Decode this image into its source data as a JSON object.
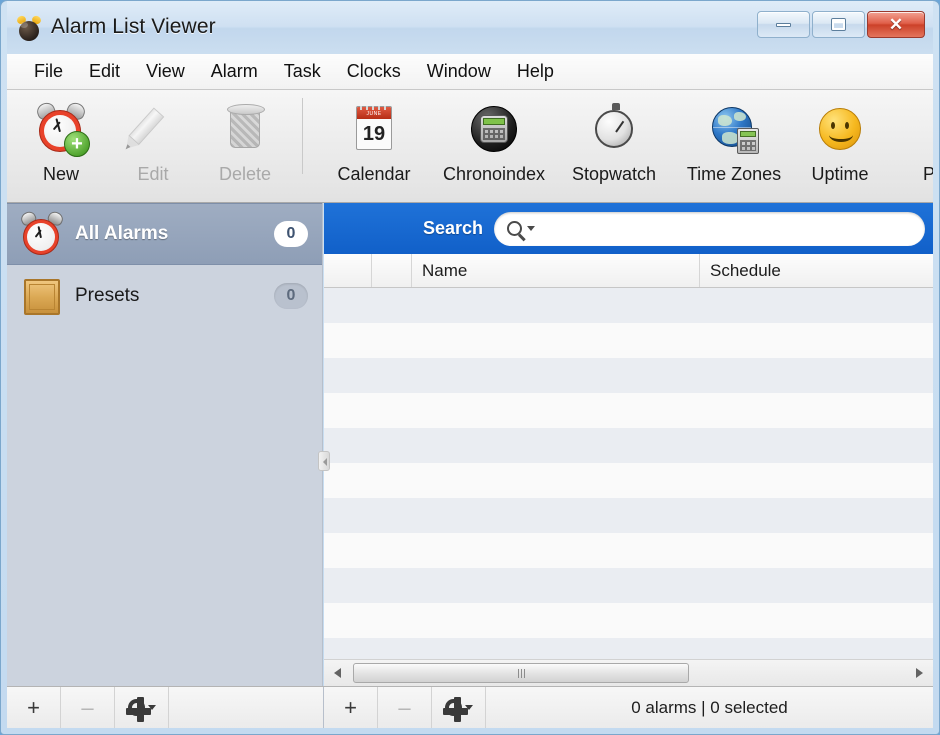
{
  "window": {
    "title": "Alarm List Viewer",
    "app_icon": "alarm-clock-icon",
    "controls": {
      "minimize": "minimize-button",
      "maximize": "maximize-button",
      "close": "close-button",
      "close_glyph": "✕"
    }
  },
  "menubar": {
    "items": [
      {
        "label": "File"
      },
      {
        "label": "Edit"
      },
      {
        "label": "View"
      },
      {
        "label": "Alarm"
      },
      {
        "label": "Task"
      },
      {
        "label": "Clocks"
      },
      {
        "label": "Window"
      },
      {
        "label": "Help"
      }
    ]
  },
  "toolbar": {
    "items": [
      {
        "label": "New",
        "icon": "new-alarm-icon",
        "enabled": true
      },
      {
        "label": "Edit",
        "icon": "pencil-icon",
        "enabled": false
      },
      {
        "label": "Delete",
        "icon": "trash-icon",
        "enabled": false
      },
      {
        "label": "Calendar",
        "icon": "calendar-icon",
        "enabled": true
      },
      {
        "label": "Chronoindex",
        "icon": "chronoindex-icon",
        "enabled": true
      },
      {
        "label": "Stopwatch",
        "icon": "stopwatch-icon",
        "enabled": true
      },
      {
        "label": "Time Zones",
        "icon": "globe-icon",
        "enabled": true
      },
      {
        "label": "Uptime",
        "icon": "smiley-icon",
        "enabled": true
      },
      {
        "label": "Pr",
        "icon": "preferences-icon",
        "enabled": true
      }
    ],
    "calendar_icon": {
      "month": "JUNE",
      "day": "19"
    }
  },
  "sidebar": {
    "items": [
      {
        "label": "All Alarms",
        "badge": "0",
        "icon": "alarm-clock-icon",
        "selected": true
      },
      {
        "label": "Presets",
        "badge": "0",
        "icon": "crate-icon",
        "selected": false
      }
    ],
    "footer": {
      "add_label": "+",
      "remove_label": "–",
      "action_label": "gear"
    }
  },
  "main": {
    "search": {
      "label": "Search",
      "value": "",
      "placeholder": "",
      "icon": "search-icon",
      "caret": "chevron-down-icon"
    },
    "columns": [
      {
        "label": ""
      },
      {
        "label": ""
      },
      {
        "label": "Name"
      },
      {
        "label": "Schedule"
      }
    ],
    "rows": [],
    "scrollbar": {
      "left_arrow": "scroll-left-icon",
      "right_arrow": "scroll-right-icon"
    },
    "footer": {
      "add_label": "+",
      "remove_label": "–",
      "action_label": "gear",
      "status": "0 alarms | 0 selected"
    }
  },
  "colors": {
    "search_bar": "#1160c9",
    "sidebar_bg": "#ccd3de",
    "selection": "#8e9eb6",
    "row_alt": "#eaedf2",
    "close_button": "#cc4129"
  }
}
